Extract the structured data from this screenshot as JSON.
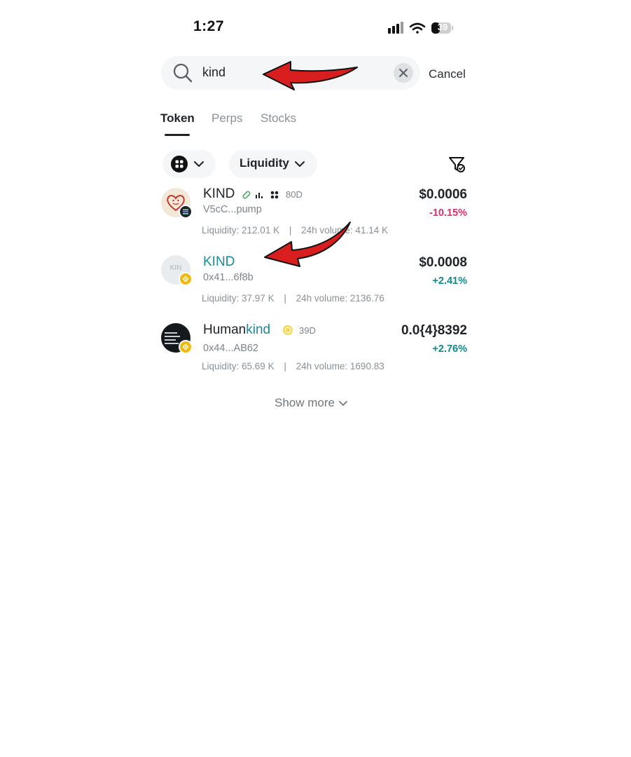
{
  "status_bar": {
    "time": "1:27",
    "battery": "39"
  },
  "search": {
    "query": "kind",
    "cancel_label": "Cancel"
  },
  "tabs": [
    {
      "label": "Token",
      "active": true
    },
    {
      "label": "Perps",
      "active": false
    },
    {
      "label": "Stocks",
      "active": false
    }
  ],
  "filters": {
    "sort_label": "Liquidity"
  },
  "tokens": [
    {
      "name": "KIND",
      "address": "V5cC...pump",
      "age": "80D",
      "price": "$0.0006",
      "change": "-10.15%",
      "liquidity": "Liquidity: 212.01 K",
      "volume": "24h volume: 41.14 K"
    },
    {
      "name": "KIND",
      "avatar_text": "KIN",
      "address": "0x41...6f8b",
      "price": "$0.0008",
      "change": "+2.41%",
      "liquidity": "Liquidity: 37.97 K",
      "volume": "24h volume: 2136.76"
    },
    {
      "name_prefix": "Human",
      "name_highlight": "kind",
      "address": "0x44...AB62",
      "age": "39D",
      "price": "0.0{4}8392",
      "change": "+2.76%",
      "liquidity": "Liquidity: 65.69 K",
      "volume": "24h volume: 1690.83"
    }
  ],
  "separator": "|",
  "show_more_label": "Show more",
  "colors": {
    "highlight": "#1a8a94",
    "positive": "#0f8a8a",
    "negative": "#e0306b",
    "annotation_arrow": "#d81e1e"
  }
}
